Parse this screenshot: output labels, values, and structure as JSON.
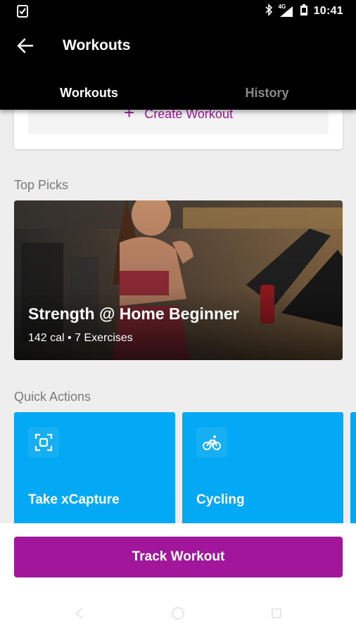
{
  "status_bar": {
    "time": "10:41",
    "network": "4G"
  },
  "app_bar": {
    "title": "Workouts",
    "tabs": [
      {
        "label": "Workouts",
        "active": true
      },
      {
        "label": "History",
        "active": false
      }
    ]
  },
  "create_workout": {
    "label": "Create Workout",
    "icon": "plus-icon"
  },
  "top_picks": {
    "section_title": "Top Picks",
    "card": {
      "title": "Strength @ Home Beginner",
      "meta": "142 cal • 7 Exercises"
    }
  },
  "quick_actions": {
    "section_title": "Quick Actions",
    "items": [
      {
        "label": "Take xCapture",
        "icon": "scan-icon"
      },
      {
        "label": "Cycling",
        "icon": "bicycle-icon"
      }
    ]
  },
  "track_button": {
    "label": "Track Workout"
  },
  "colors": {
    "accent": "#a0179c",
    "quick_action": "#03a9f4",
    "app_bar": "#000000"
  }
}
